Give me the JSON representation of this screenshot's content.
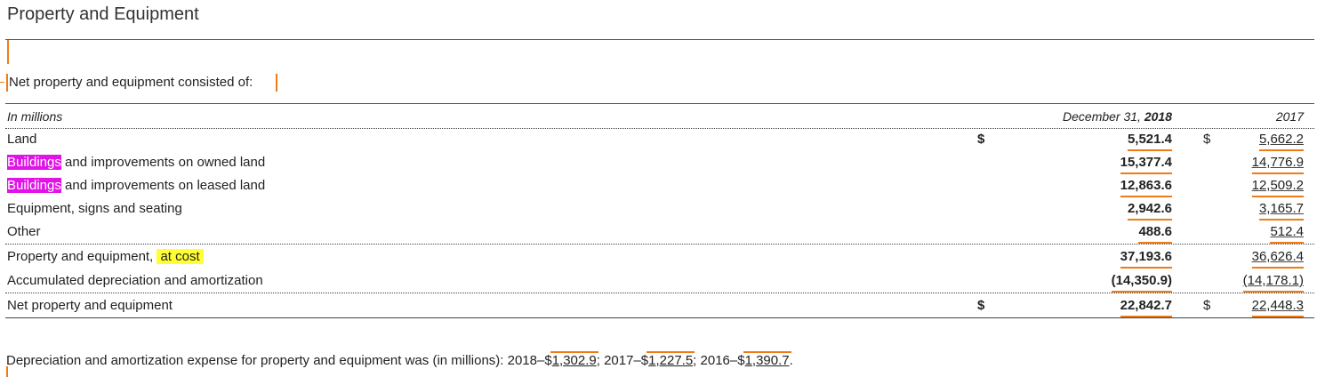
{
  "title": "Property and Equipment",
  "intro": "Net property and equipment consisted of:",
  "table": {
    "header": {
      "label": "In millions",
      "col_2018_prefix": "December 31, ",
      "col_2018_year": "2018",
      "col_2017": "2017"
    },
    "rows": [
      {
        "label_pre": "",
        "label_hl": "",
        "label_post": "Land",
        "cur_2018": "$",
        "v2018": "5,521.4",
        "cur_2017": "$",
        "v2017": "5,662.2"
      },
      {
        "label_pre": "",
        "label_hl": "Buildings",
        "label_post": " and improvements on owned land",
        "cur_2018": "",
        "v2018": "15,377.4",
        "cur_2017": "",
        "v2017": "14,776.9"
      },
      {
        "label_pre": "",
        "label_hl": "Buildings",
        "label_post": " and improvements on leased land",
        "cur_2018": "",
        "v2018": "12,863.6",
        "cur_2017": "",
        "v2017": "12,509.2"
      },
      {
        "label_pre": "",
        "label_hl": "",
        "label_post": "Equipment, signs and seating",
        "cur_2018": "",
        "v2018": "2,942.6",
        "cur_2017": "",
        "v2017": "3,165.7"
      },
      {
        "label_pre": "",
        "label_hl": "",
        "label_post": "Other",
        "cur_2018": "",
        "v2018": "488.6",
        "cur_2017": "",
        "v2017": "512.4"
      },
      {
        "label_pre": "Property and equipment, ",
        "label_hl": "at cost",
        "label_post": "",
        "cur_2018": "",
        "v2018": "37,193.6",
        "cur_2017": "",
        "v2017": "36,626.4"
      },
      {
        "label_pre": "",
        "label_hl": "",
        "label_post": "Accumulated depreciation and amortization",
        "cur_2018": "",
        "v2018": "(14,350.9)",
        "cur_2017": "",
        "v2017": "(14,178.1)"
      },
      {
        "label_pre": "",
        "label_hl": "",
        "label_post": "Net property and equipment",
        "cur_2018": "$",
        "v2018": "22,842.7",
        "cur_2017": "$",
        "v2017": "22,448.3"
      }
    ]
  },
  "footnote": {
    "text_a": "Depreciation and amortization expense for property and equipment was (in millions): 2018–$",
    "amt_2018": "1,302.9",
    "text_b": "; 2017–$",
    "amt_2017": "1,227.5",
    "text_c": "; 2016–$",
    "amt_2016": "1,390.7",
    "text_d": "."
  },
  "colors": {
    "text": "#222222",
    "rule": "#555555",
    "caret_orange": "#f07b16",
    "highlight_magenta": "#e014e6",
    "highlight_yellow": "#ffff33"
  }
}
